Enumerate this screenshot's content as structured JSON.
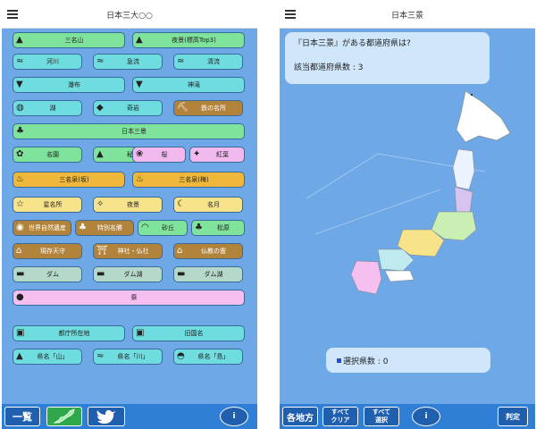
{
  "left": {
    "title": "日本三大○○",
    "buttons": [
      {
        "label": "三名山",
        "icon": "mountain-icon",
        "color": "green"
      },
      {
        "label": "夜景(標高Top3)",
        "icon": "mountain-icon",
        "color": "green"
      },
      {
        "label": "河川",
        "icon": "river-icon",
        "color": "cyan"
      },
      {
        "label": "急流",
        "icon": "river-icon",
        "color": "cyan"
      },
      {
        "label": "清流",
        "icon": "river-icon",
        "color": "cyan"
      },
      {
        "label": "瀑布",
        "icon": "waterfall-icon",
        "color": "cyan"
      },
      {
        "label": "神滝",
        "icon": "waterfall-icon",
        "color": "cyan"
      },
      {
        "label": "湖",
        "icon": "lake-icon",
        "color": "cyan"
      },
      {
        "label": "奇岩",
        "icon": "rock-icon",
        "color": "cyan"
      },
      {
        "label": "鉄の名所",
        "icon": "mine-icon",
        "color": "brown"
      },
      {
        "label": "日本三景",
        "icon": "pine-icon",
        "color": "green"
      },
      {
        "label": "名園",
        "icon": "garden-icon",
        "color": "green"
      },
      {
        "label": "秘境",
        "icon": "valley-icon",
        "color": "green"
      },
      {
        "label": "桜",
        "icon": "sakura-icon",
        "color": "pink"
      },
      {
        "label": "紅葉",
        "icon": "maple-icon",
        "color": "pink"
      },
      {
        "label": "三名泉(坂)",
        "icon": "onsen-icon",
        "color": "orange"
      },
      {
        "label": "三名泉(梅)",
        "icon": "onsen-icon",
        "color": "orange"
      },
      {
        "label": "星名所",
        "icon": "star-icon",
        "color": "yellow"
      },
      {
        "label": "夜景",
        "icon": "nightview-icon",
        "color": "yellow"
      },
      {
        "label": "名月",
        "icon": "moon-icon",
        "color": "yellow"
      },
      {
        "label": "世界自然遺産",
        "icon": "globe-icon",
        "color": "brown"
      },
      {
        "label": "特別名勝",
        "icon": "pine-icon",
        "color": "brown"
      },
      {
        "label": "砂丘",
        "icon": "dune-icon",
        "color": "green"
      },
      {
        "label": "松原",
        "icon": "pine-icon",
        "color": "green"
      },
      {
        "label": "現存天守",
        "icon": "castle-icon",
        "color": "brown"
      },
      {
        "label": "神社・仏社",
        "icon": "torii-icon",
        "color": "brown"
      },
      {
        "label": "仏教の霊",
        "icon": "temple-icon",
        "color": "brown"
      },
      {
        "label": "ダム",
        "icon": "dam-icon",
        "color": "gray"
      },
      {
        "label": "ダム湖",
        "icon": "dam-icon",
        "color": "gray"
      },
      {
        "label": "ダム湖",
        "icon": "dam-icon",
        "color": "gray"
      },
      {
        "label": "祭",
        "icon": "festival-icon",
        "color": "rose"
      },
      {
        "label": "都庁所在地",
        "icon": "building-icon",
        "color": "cyan"
      },
      {
        "label": "旧国名",
        "icon": "building-icon",
        "color": "cyan"
      },
      {
        "label": "県名「山」",
        "icon": "mountain-icon",
        "color": "cyan"
      },
      {
        "label": "県名「川」",
        "icon": "river-icon",
        "color": "cyan"
      },
      {
        "label": "県名「島」",
        "icon": "island-icon",
        "color": "cyan"
      }
    ],
    "footer": {
      "list": "一覧",
      "map_icon": "japan-map-icon",
      "bird_icon": "twitter-icon",
      "info": "i"
    }
  },
  "right": {
    "title": "日本三景",
    "question": "『日本三景』がある都道府県は?",
    "count_label": "該当都道府県数 : 3",
    "selected_label": "選択県数 : 0",
    "footer": {
      "regions": "各地方",
      "clear_top": "すべて",
      "clear_bottom": "クリア",
      "select_top": "すべて",
      "select_bottom": "選択",
      "info": "i",
      "judge": "判定"
    }
  },
  "colors": {
    "phone_bg": "#6fa8e6",
    "footer": "#2f7fd6",
    "panel": "#cfe6fb"
  }
}
